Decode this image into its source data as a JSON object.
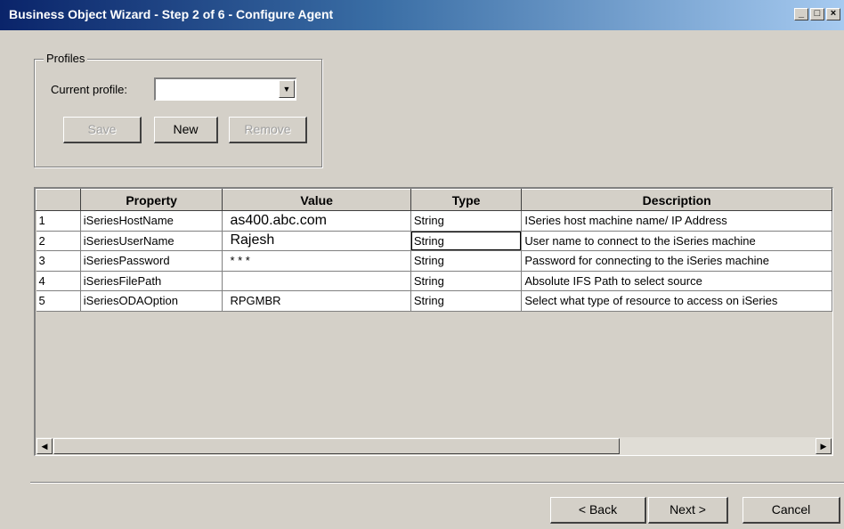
{
  "window": {
    "title": "Business Object Wizard - Step 2 of 6 - Configure Agent",
    "controls": {
      "minimize": "_",
      "maximize": "□",
      "close": "×"
    }
  },
  "profiles": {
    "legend": "Profiles",
    "current_profile_label": "Current profile:",
    "current_profile_value": "",
    "save_label": "Save",
    "new_label": "New",
    "remove_label": "Remove"
  },
  "grid": {
    "columns": [
      "",
      "Property",
      "Value",
      "Type",
      "Description"
    ],
    "rows": [
      {
        "num": "1",
        "property": "iSeriesHostName",
        "value": "as400.abc.com",
        "type": "String",
        "description": "ISeries host machine name/ IP Address"
      },
      {
        "num": "2",
        "property": "iSeriesUserName",
        "value": "Rajesh",
        "type": "String",
        "description": "User name to connect to the iSeries machine"
      },
      {
        "num": "3",
        "property": "iSeriesPassword",
        "value": "* * *",
        "type": "String",
        "description": "Password for connecting to the iSeries machine"
      },
      {
        "num": "4",
        "property": "iSeriesFilePath",
        "value": "",
        "type": "String",
        "description": "Absolute IFS Path to select source"
      },
      {
        "num": "5",
        "property": "iSeriesODAOption",
        "value": "RPGMBR",
        "type": "String",
        "description": "Select what type of resource to access on iSeries"
      }
    ]
  },
  "footer": {
    "back_label": "< Back",
    "next_label": "Next >",
    "cancel_label": "Cancel"
  }
}
